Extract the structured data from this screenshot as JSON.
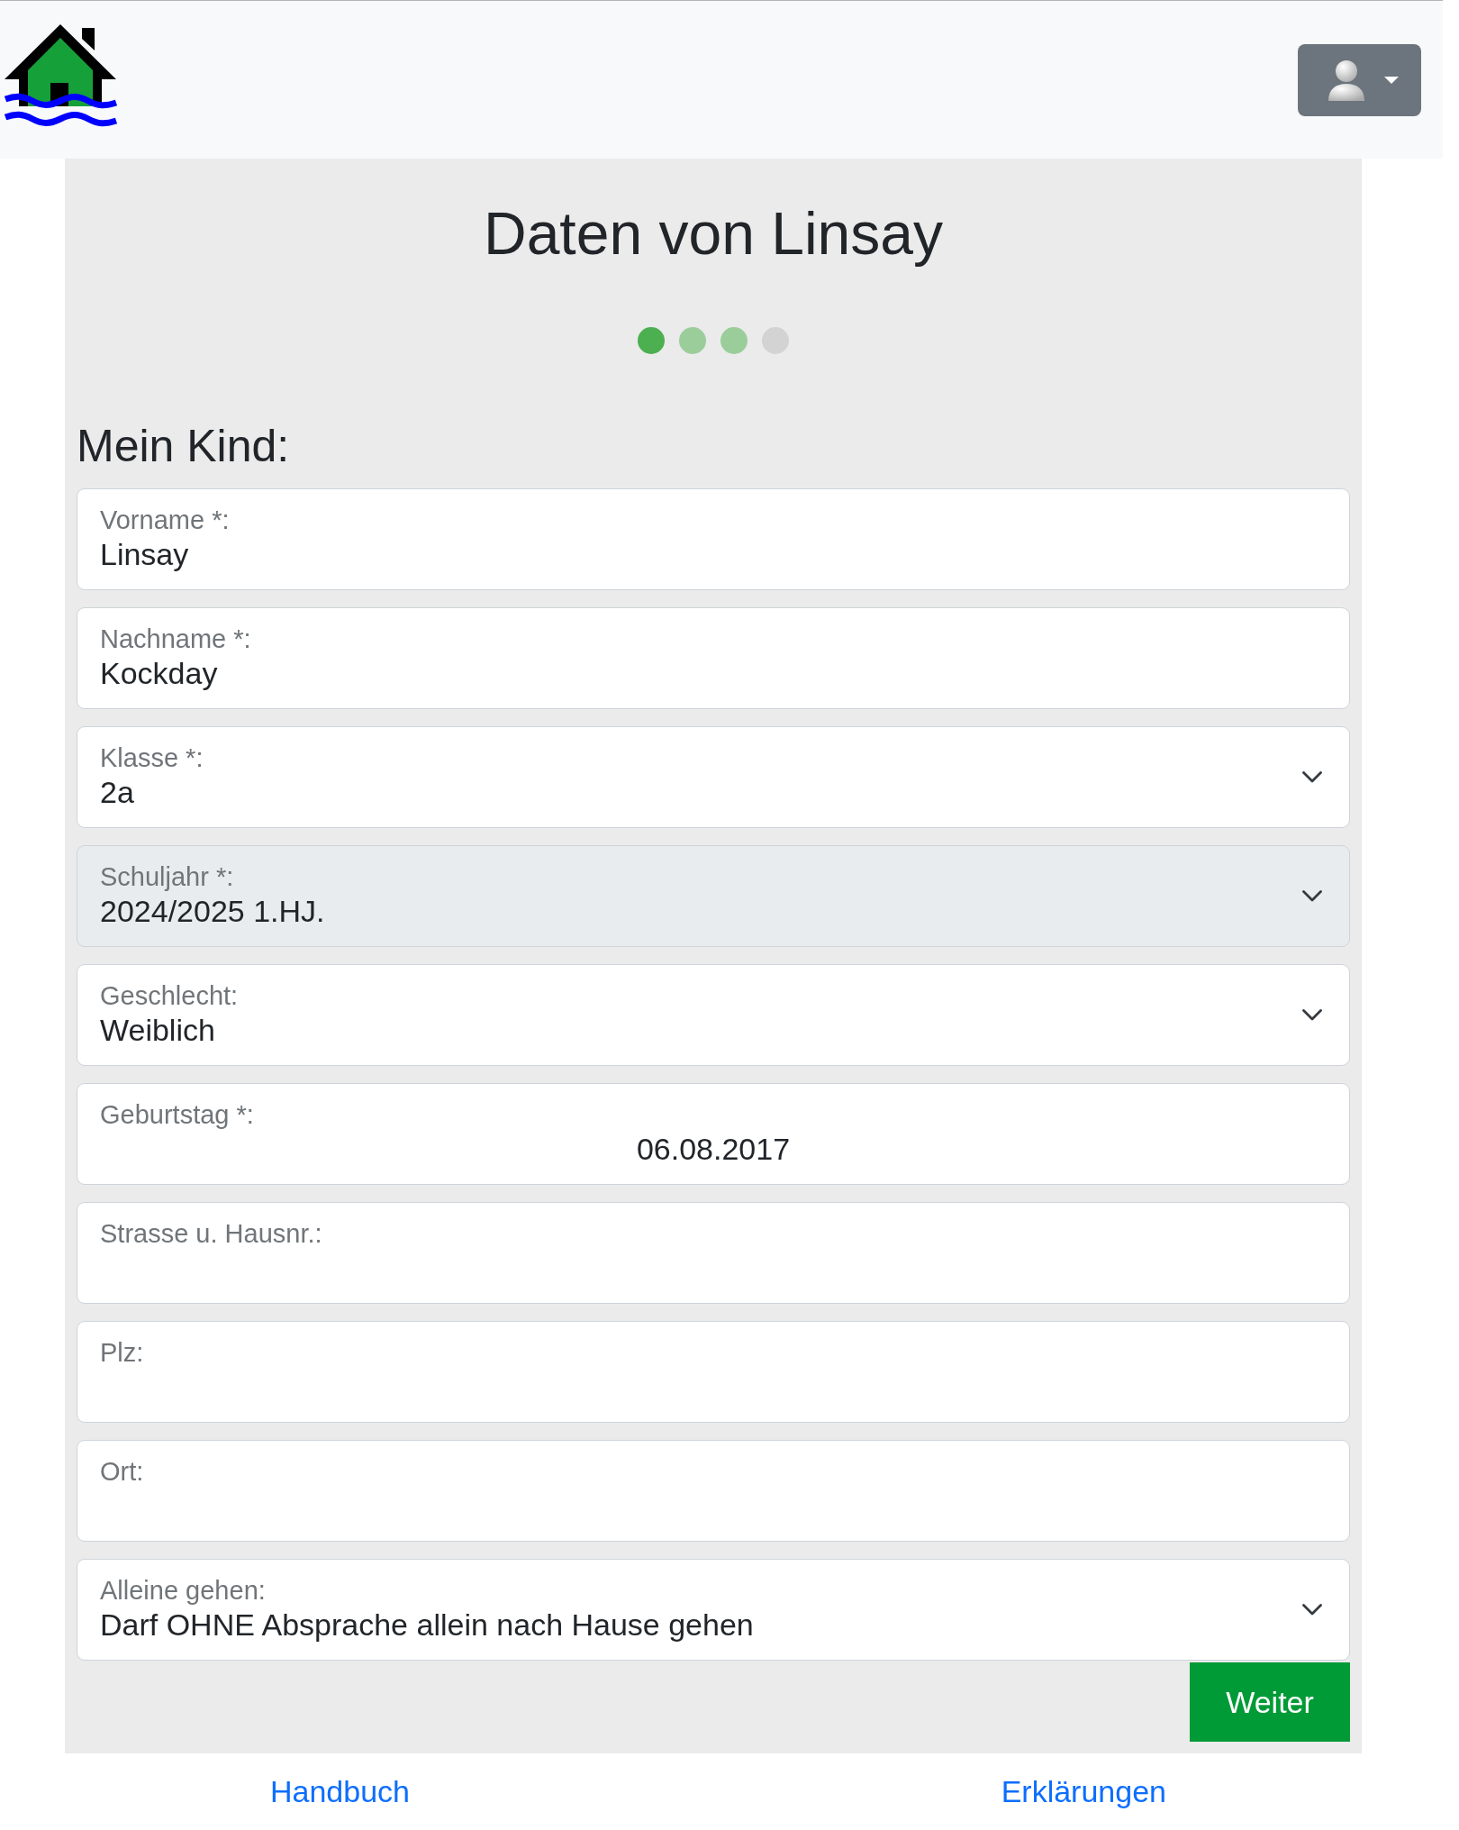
{
  "page": {
    "title": "Daten von Linsay"
  },
  "steps": [
    {
      "selected": true,
      "disabled": false
    },
    {
      "selected": false,
      "disabled": false
    },
    {
      "selected": false,
      "disabled": false
    },
    {
      "selected": false,
      "disabled": true
    }
  ],
  "section": {
    "heading": "Mein Kind:"
  },
  "fields": [
    {
      "kind": "text",
      "label": "Vorname *:",
      "value": "Linsay",
      "disabled": false
    },
    {
      "kind": "text",
      "label": "Nachname *:",
      "value": "Kockday",
      "disabled": false
    },
    {
      "kind": "select",
      "label": "Klasse *:",
      "value": "2a",
      "disabled": false
    },
    {
      "kind": "select",
      "label": "Schuljahr *:",
      "value": "2024/2025 1.HJ.",
      "disabled": true
    },
    {
      "kind": "select",
      "label": "Geschlecht:",
      "value": "Weiblich",
      "disabled": false
    },
    {
      "kind": "date",
      "label": "Geburtstag *:",
      "value": "06.08.2017",
      "disabled": false
    },
    {
      "kind": "text",
      "label": "Strasse u. Hausnr.:",
      "disabled": false
    },
    {
      "kind": "text",
      "label": "Plz:",
      "disabled": false
    },
    {
      "kind": "text",
      "label": "Ort:",
      "disabled": false
    },
    {
      "kind": "select",
      "label": "Alleine gehen:",
      "value": "Darf OHNE Absprache allein nach Hause gehen",
      "disabled": false
    }
  ],
  "submit_button": {
    "label": "Weiter"
  },
  "footer_links": [
    "Handbuch",
    "Erklärungen"
  ]
}
